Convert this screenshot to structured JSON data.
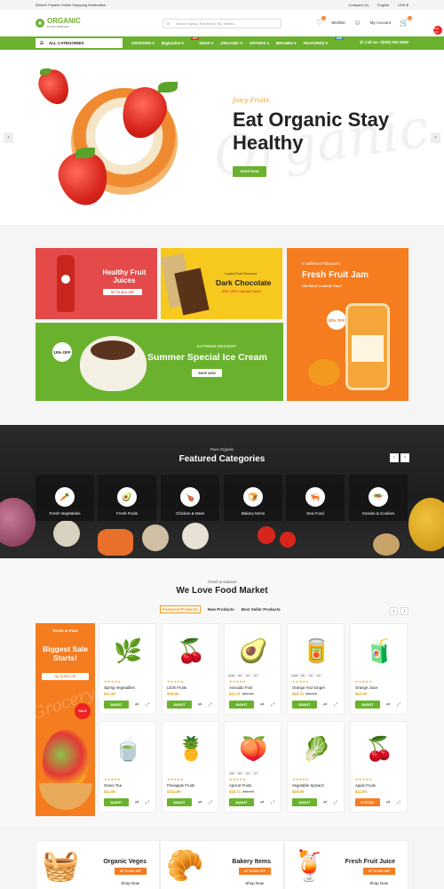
{
  "topbar": {
    "tagline": "World's Fastest Online Shopping Destination",
    "compare": "Compare (0)",
    "language": "English",
    "currency": "USD $"
  },
  "header": {
    "logo_title": "ORGANIC",
    "logo_sub": "FOOD MARKET",
    "search_placeholder": "Search laptop, Electronic, Sp, lenses...",
    "wishlist": "Wishlist",
    "wishlist_count": "0",
    "account": "My Account",
    "cart_count": "0"
  },
  "nav": {
    "all_categories": "ALL CATEGORIES",
    "items": [
      {
        "label": "GROFERS"
      },
      {
        "label": "Bigbasket",
        "tag": "HOT"
      },
      {
        "label": "SHOP"
      },
      {
        "label": "ORGANIC"
      },
      {
        "label": "OFFERS"
      },
      {
        "label": "BRANDS"
      },
      {
        "label": "FEATURES",
        "tag": "NEW"
      }
    ],
    "call": "Call Us +(000) 000 0000",
    "side_badge": "40% OFF"
  },
  "hero": {
    "subtitle": "Juicy Fruits",
    "title": "Eat Organic Stay Healthy",
    "button": "SHOP NOW",
    "watermark": "Organic"
  },
  "promos": [
    {
      "title": "Healthy Fruit Juices",
      "pill": "UP TO 40% OFF"
    },
    {
      "small": "Loaded Fruit Flavoured",
      "title": "Dark Chocolate",
      "offer": "50% OFF Limited Time*"
    },
    {
      "small": "In Different Flavoures",
      "title": "Fresh Fruit Jam",
      "offer": "ON SALE Limited Time*",
      "badge": "30% OFF"
    },
    {
      "small": "EXTREME DESSERT",
      "title": "Summer Special Ice Cream",
      "button": "SHOP NOW",
      "badge": "10% OFF"
    }
  ],
  "categories": {
    "eyebrow": "Pure Organic",
    "title": "Featured Categories",
    "items": [
      {
        "label": "Fresh Vegetables",
        "icon": "🥕"
      },
      {
        "label": "Fresh Fruits",
        "icon": "🥑"
      },
      {
        "label": "Chicken & Meat",
        "icon": "🍗"
      },
      {
        "label": "Bakery Items",
        "icon": "🍞"
      },
      {
        "label": "Sea Food",
        "icon": "🦐"
      },
      {
        "label": "Snacks & Cookies",
        "icon": "🥗"
      }
    ]
  },
  "products": {
    "eyebrow": "Fresh & Natural",
    "title": "We Love Food Market",
    "tabs": [
      "Featured Products",
      "New Products",
      "Best Seller Products"
    ],
    "side_banner": {
      "eyebrow": "Fresh & Pure",
      "title": "Biggest Sale Starts!",
      "pill": "Up To 80% Off",
      "sale": "SALE",
      "watermark": "Grocery"
    },
    "add_label": "BASKET",
    "items": [
      {
        "name": "Spring Vegetables",
        "price": "$11.90",
        "old": "",
        "icon": "🌿",
        "btn": "BASKET"
      },
      {
        "name": "Litchi Fruits",
        "price": "$18.90",
        "old": "",
        "icon": "🍒",
        "btn": "BASKET"
      },
      {
        "name": "Avocado Fruit",
        "price": "$11.21",
        "old": "$11.90",
        "icon": "🥑",
        "btn": "BASKET",
        "timer": [
          "0 DAY",
          "05",
          "04",
          "07"
        ]
      },
      {
        "name": "Orange And Ginger",
        "price": "$10.71",
        "old": "$11.90",
        "icon": "🥫",
        "btn": "BASKET",
        "timer": [
          "1 DAY",
          "05",
          "04",
          "07"
        ]
      },
      {
        "name": "Orange Juice",
        "price": "$27.90",
        "old": "",
        "icon": "🧃",
        "btn": "BASKET"
      },
      {
        "name": "Green Tea",
        "price": "$11.90",
        "old": "",
        "icon": "🍵",
        "btn": "BASKET"
      },
      {
        "name": "Pineapple Fruits",
        "price": "$312.90",
        "old": "",
        "icon": "🍍",
        "btn": "BASKET"
      },
      {
        "name": "Apricot Fruits",
        "price": "$10.71",
        "old": "$11.90",
        "icon": "🍑",
        "btn": "BASKET",
        "timer": [
          "115",
          "05",
          "04",
          "07"
        ]
      },
      {
        "name": "Vegetable Spinach",
        "price": "$18.90",
        "old": "",
        "icon": "🥬",
        "btn": "BASKET"
      },
      {
        "name": "Apple Fruits",
        "price": "$11.90",
        "old": "",
        "icon": "🍒",
        "btn": "IN STOCK",
        "orange": true
      }
    ]
  },
  "bottom_banners": [
    {
      "title": "Organic Veges",
      "pill": "UP TO 40% OFF",
      "link": "Shop Now",
      "icon": "🧺"
    },
    {
      "title": "Bakery Items",
      "pill": "UP TO 50% OFF",
      "link": "Shop Now",
      "icon": "🥐"
    },
    {
      "title": "Fresh Fruit Juice",
      "pill": "UP TO 30% OFF",
      "link": "Shop Now",
      "icon": "🍹"
    }
  ],
  "colors": {
    "brand_green": "#6ab22e",
    "accent_orange": "#f57c1f",
    "promo_red": "#e44a4a",
    "promo_yellow": "#f7c81e"
  }
}
